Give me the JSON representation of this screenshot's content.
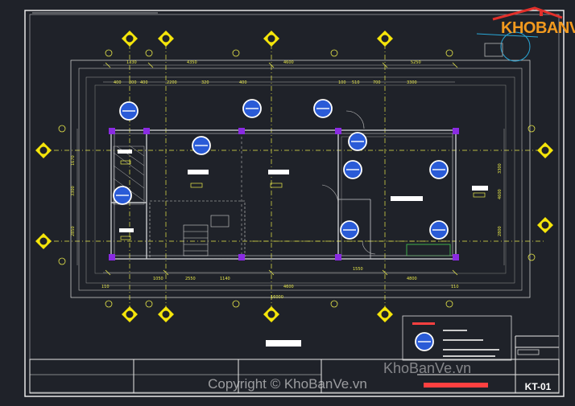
{
  "drawing": {
    "sheet_code": "KT-01",
    "background": "#1f2229",
    "colors": {
      "grid": "#e8e84a",
      "marker": "#f5e50a",
      "wall": "#c7c9cc",
      "outline": "#e8e8e8",
      "dim": "#ff7070",
      "accent": "#8a2be2",
      "light": "#2a5bd7",
      "text": "#ffffff"
    }
  },
  "dimensions_top_outer": [
    "1330",
    "4350",
    "4600",
    "5250"
  ],
  "dimensions_top_inner": [
    "400",
    "800",
    "400",
    "2200",
    "320",
    "400",
    "100",
    "510",
    "700",
    "3300"
  ],
  "dimensions_bottom": [
    "110",
    "1050",
    "2550",
    "1140",
    "4600",
    "1550",
    "4800",
    "110"
  ],
  "dimensions_left": [
    "1670",
    "3300",
    "2850"
  ],
  "dimensions_right": [
    "3300",
    "4600",
    "2800"
  ],
  "overall_width": "16000",
  "logo": {
    "text": "KHOBANVE"
  },
  "watermark": {
    "main": "Copyright © KhoBanVe.vn",
    "secondary": "KhoBanVe.vn"
  }
}
